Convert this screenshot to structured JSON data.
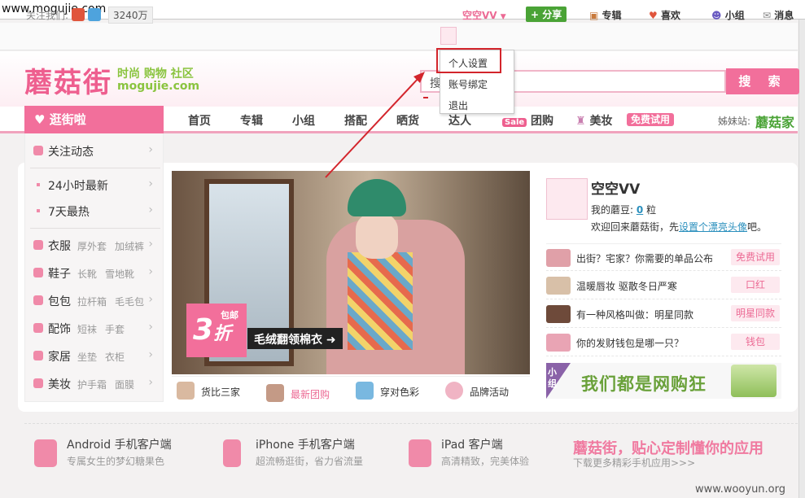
{
  "browser": {
    "url": "www.mogujie.com"
  },
  "topbar": {
    "follow_label": "关注我们:",
    "follower_count": "3240万",
    "user_name": "空空VV",
    "share_label": "分享",
    "links": [
      "专辑",
      "喜欢",
      "小组",
      "消息"
    ]
  },
  "header": {
    "logo": "蘑菇街",
    "slogan": "时尚 购物 社区",
    "domain": "mogujie.com",
    "search_value": "搜",
    "search_button": "搜 索"
  },
  "dropdown": {
    "items": [
      "个人设置",
      "账号绑定",
      "退出"
    ]
  },
  "nav": {
    "main_tab": "逛街啦",
    "items": [
      "首页",
      "专辑",
      "小组",
      "搭配",
      "晒货",
      "达人",
      "团购",
      "美妆"
    ],
    "sale_badge": "Sale",
    "free_trial": "免费试用",
    "sister_label": "姊妹站:",
    "sister_site": "蘑菇家"
  },
  "sidebar": {
    "follow": "关注动态",
    "latest": "24小时最新",
    "hot": "7天最热",
    "categories": [
      {
        "label": "衣服",
        "subs": [
          "厚外套",
          "加绒裤"
        ]
      },
      {
        "label": "鞋子",
        "subs": [
          "长靴",
          "雪地靴"
        ]
      },
      {
        "label": "包包",
        "subs": [
          "拉杆箱",
          "毛毛包"
        ]
      },
      {
        "label": "配饰",
        "subs": [
          "短袜",
          "手套"
        ]
      },
      {
        "label": "家居",
        "subs": [
          "坐垫",
          "衣柜"
        ]
      },
      {
        "label": "美妆",
        "subs": [
          "护手霜",
          "面膜"
        ]
      }
    ]
  },
  "banner": {
    "promo_number": "3",
    "promo_unit": "折",
    "promo_small": [
      "包邮"
    ],
    "promo_text": "毛绒翻领棉衣"
  },
  "banner_tabs": [
    "货比三家",
    "最新团购",
    "穿对色彩",
    "品牌活动"
  ],
  "profile": {
    "name": "空空VV",
    "beans_label": "我的蘑豆:",
    "beans_value": "0",
    "beans_unit": "粒",
    "welcome_prefix": "欢迎回来蘑菇街，先",
    "welcome_link": "设置个漂亮头像",
    "welcome_suffix": "吧。"
  },
  "feed": [
    {
      "text": "出街？宅家？你需要的单品公布",
      "tag": "免费试用"
    },
    {
      "text": "温暖唇妆 驱散冬日严寒",
      "tag": "口红"
    },
    {
      "text": "有一种风格叫做：明星同款",
      "tag": "明星同款"
    },
    {
      "text": "你的发财钱包是哪一只？",
      "tag": "钱包"
    }
  ],
  "group": {
    "tag": "小组",
    "slogan": "我们都是网购狂"
  },
  "apps": [
    {
      "name": "Android 手机客户端",
      "desc": "专属女生的梦幻糖果色"
    },
    {
      "name": "iPhone 手机客户端",
      "desc": "超流畅逛街，省力省流量"
    },
    {
      "name": "iPad 客户端",
      "desc": "高清精致，完美体验"
    }
  ],
  "footer": {
    "slogan": "蘑菇街，贴心定制懂你的应用",
    "sub": "下载更多精彩手机应用>>>"
  },
  "watermark": "www.wooyun.org",
  "colors": {
    "brand_pink": "#f26f9b",
    "green": "#8ac43f",
    "annotation_red": "#d3252c"
  }
}
